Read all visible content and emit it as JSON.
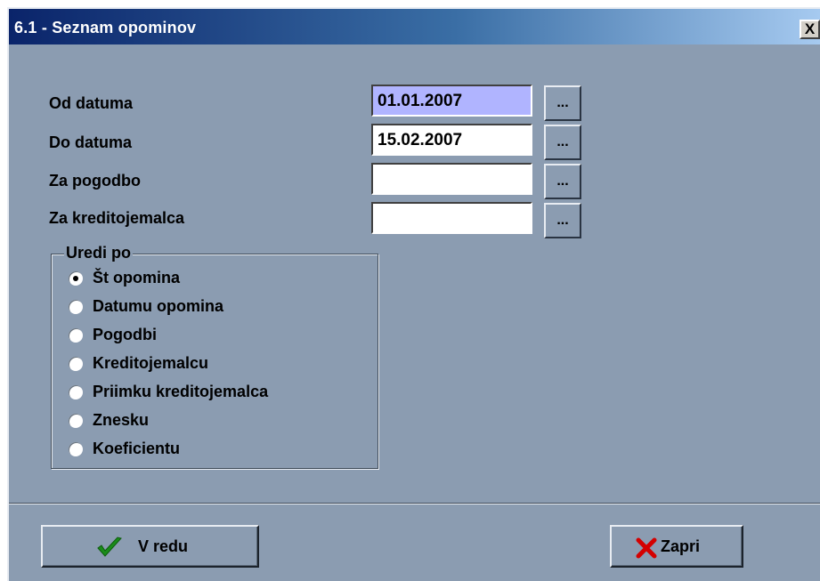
{
  "window": {
    "title": "6.1 - Seznam opominov",
    "close_label": "X"
  },
  "form": {
    "od_datuma": {
      "label": "Od datuma",
      "value": "01.01.2007"
    },
    "do_datuma": {
      "label": "Do datuma",
      "value": "15.02.2007"
    },
    "za_pogodbo": {
      "label": "Za pogodbo",
      "value": ""
    },
    "za_kreditojemalca": {
      "label": "Za kreditojemalca",
      "value": ""
    },
    "browse_label": "..."
  },
  "sort": {
    "legend": "Uredi po",
    "options": [
      {
        "label": "Št opomina",
        "selected": true
      },
      {
        "label": "Datumu opomina",
        "selected": false
      },
      {
        "label": "Pogodbi",
        "selected": false
      },
      {
        "label": "Kreditojemalcu",
        "selected": false
      },
      {
        "label": "Priimku kreditojemalca",
        "selected": false
      },
      {
        "label": "Znesku",
        "selected": false
      },
      {
        "label": "Koeficientu",
        "selected": false
      }
    ]
  },
  "buttons": {
    "ok": {
      "label": "V redu",
      "icon": "checkmark-icon",
      "color": "#1a8c1a"
    },
    "close": {
      "label": "Zapri",
      "icon": "x-icon",
      "color": "#d40000"
    }
  }
}
